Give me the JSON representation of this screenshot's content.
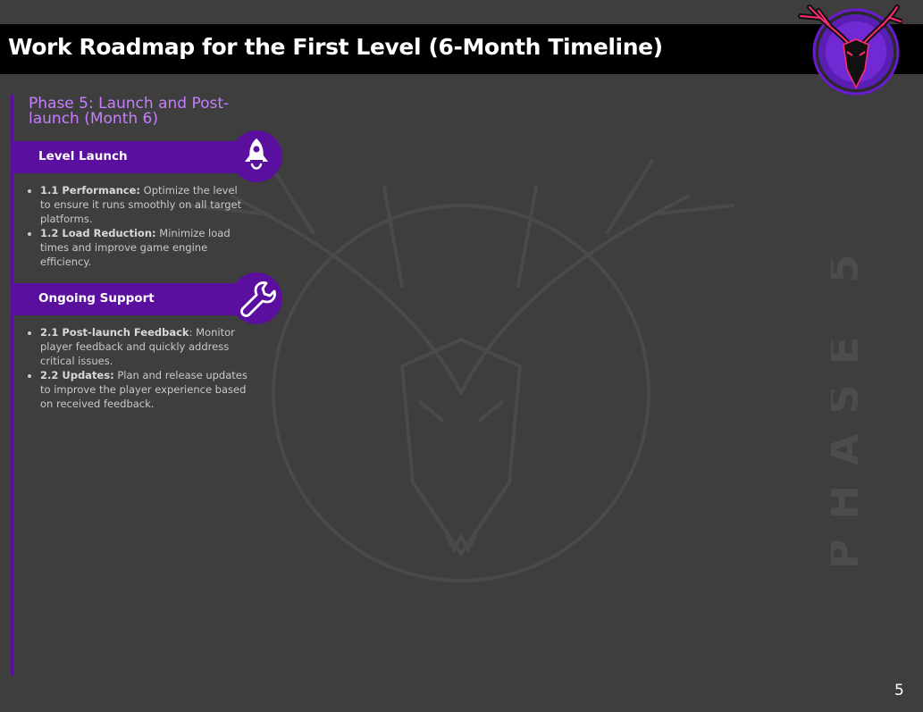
{
  "header": {
    "title": "Work Roadmap for the First Level (6-Month Timeline)"
  },
  "logo": {
    "name": "deer-skull-logo"
  },
  "watermark": {
    "name": "deer-skull-watermark",
    "vertical_text": "PHASE 5"
  },
  "phase": {
    "title": "Phase 5: Launch and Post-launch (Month 6)"
  },
  "sections": [
    {
      "label": "Level Launch",
      "icon": "rocket-icon",
      "items": [
        {
          "bold": "1.1 Performance:",
          "text": " Optimize the level to ensure it runs smoothly on all target platforms."
        },
        {
          "bold": "1.2 Load Reduction:",
          "text": " Minimize load times and improve game engine efficiency."
        }
      ]
    },
    {
      "label": "Ongoing Support",
      "icon": "wrench-icon",
      "items": [
        {
          "bold": "2.1 Post-launch Feedback",
          "text": ": Monitor player feedback and quickly address critical issues."
        },
        {
          "bold": "2.2 Updates:",
          "text": " Plan and release updates to improve the player experience based on received feedback."
        }
      ]
    }
  ],
  "footer": {
    "page_number": "5"
  },
  "colors": {
    "background": "#3e3e3e",
    "accent_purple": "#5b0f9e",
    "title_purple": "#c77dff",
    "logo_pink": "#ff2d6f",
    "logo_circle": "#6a1bd1"
  }
}
